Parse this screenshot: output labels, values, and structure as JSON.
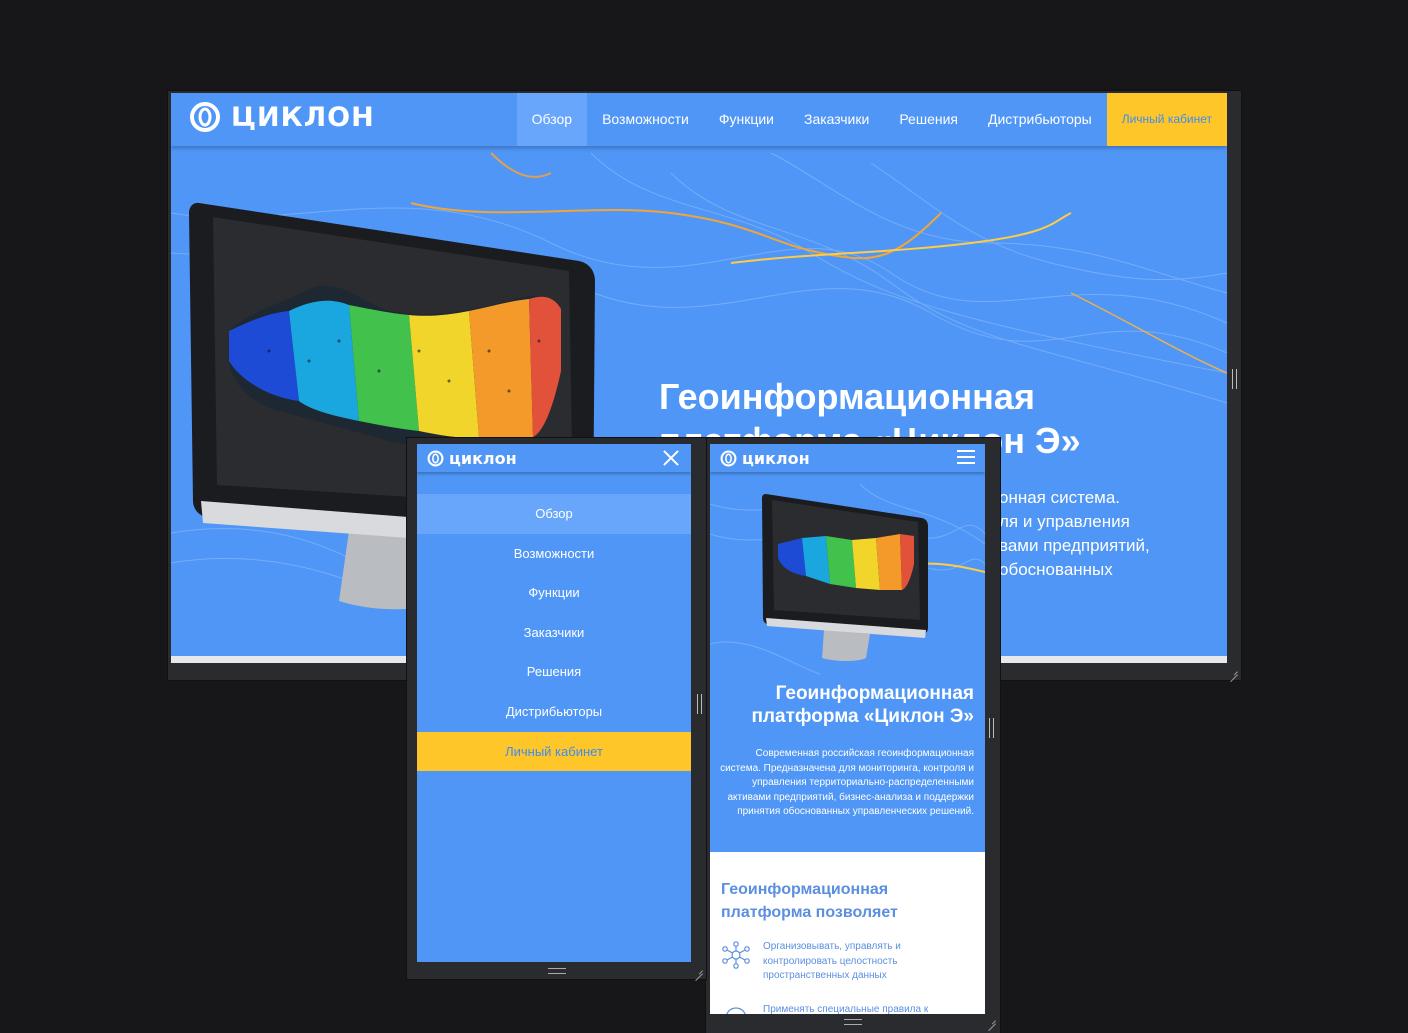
{
  "brand": {
    "name": "ЦИКЛОН",
    "name_mobile": "циклон"
  },
  "colors": {
    "primary": "#4f96f7",
    "active": "#67a6fb",
    "cta": "#ffc629",
    "cta_text": "#3f8cf2",
    "background": "#17171a",
    "section_heading": "#5b8fe0"
  },
  "nav": {
    "items": [
      {
        "label": "Обзор",
        "active": true
      },
      {
        "label": "Возможности"
      },
      {
        "label": "Функции"
      },
      {
        "label": "Заказчики"
      },
      {
        "label": "Решения"
      },
      {
        "label": "Дистрибьюторы"
      }
    ],
    "cta": "Личный кабинет"
  },
  "hero": {
    "title_line1": "Геоинформационная",
    "title_line2": "платформа «Циклон Э»",
    "desktop_subtitle_lines": [
      "онная система.",
      "ля и управления",
      "вами предприятий,",
      "обоснованных"
    ],
    "subtitle": "Современная российская геоинформационная система. Предназначена для мониторинга, контроля и управления территориально-распределенными активами предприятий, бизнес-анализа и поддержки принятия обоснованных управленческих решений."
  },
  "section": {
    "title": "Геоинформационная платформа позволяет",
    "features": [
      {
        "icon": "network-icon",
        "text": "Организовывать, управлять и контролировать целостность пространственных данных"
      },
      {
        "icon": "rules-icon",
        "text": "Применять специальные правила к"
      }
    ]
  },
  "icons": {
    "logo": "ring-logo-icon",
    "close": "close-icon",
    "menu": "hamburger-icon"
  }
}
